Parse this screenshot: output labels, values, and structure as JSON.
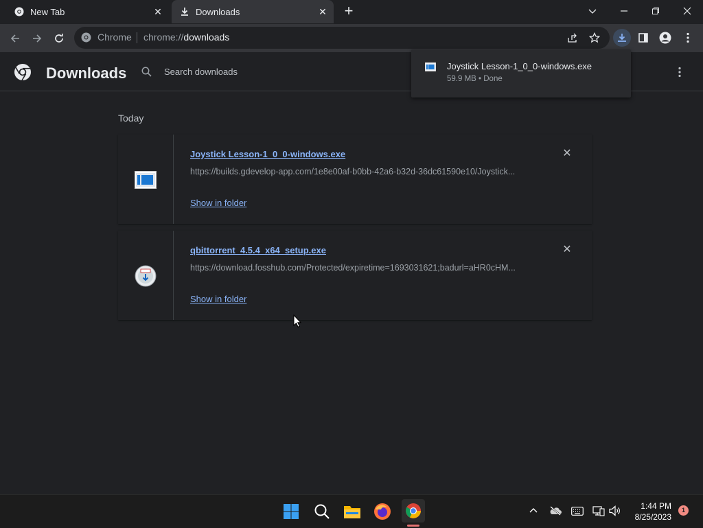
{
  "tabs": [
    {
      "label": "New Tab"
    },
    {
      "label": "Downloads"
    }
  ],
  "omnibox": {
    "site_label": "Chrome",
    "url_prefix": "chrome://",
    "url_path": "downloads"
  },
  "page": {
    "title": "Downloads",
    "search_placeholder": "Search downloads",
    "section_label": "Today"
  },
  "downloads": [
    {
      "file_name": "Joystick Lesson-1_0_0-windows.exe",
      "url": "https://builds.gdevelop-app.com/1e8e00af-b0bb-42a6-b32d-36dc61590e10/Joystick...",
      "action": "Show in folder"
    },
    {
      "file_name": "qbittorrent_4.5.4_x64_setup.exe",
      "url": "https://download.fosshub.com/Protected/expiretime=1693031621;badurl=aHR0cHM...",
      "action": "Show in folder"
    }
  ],
  "popup": {
    "file_name": "Joystick Lesson-1_0_0-windows.exe",
    "status": "59.9 MB • Done"
  },
  "taskbar": {
    "time": "1:44 PM",
    "date": "8/25/2023",
    "notification_count": "1"
  },
  "colors": {
    "accent": "#8ab4f8",
    "background": "#202124",
    "toolbar": "#35363a"
  }
}
